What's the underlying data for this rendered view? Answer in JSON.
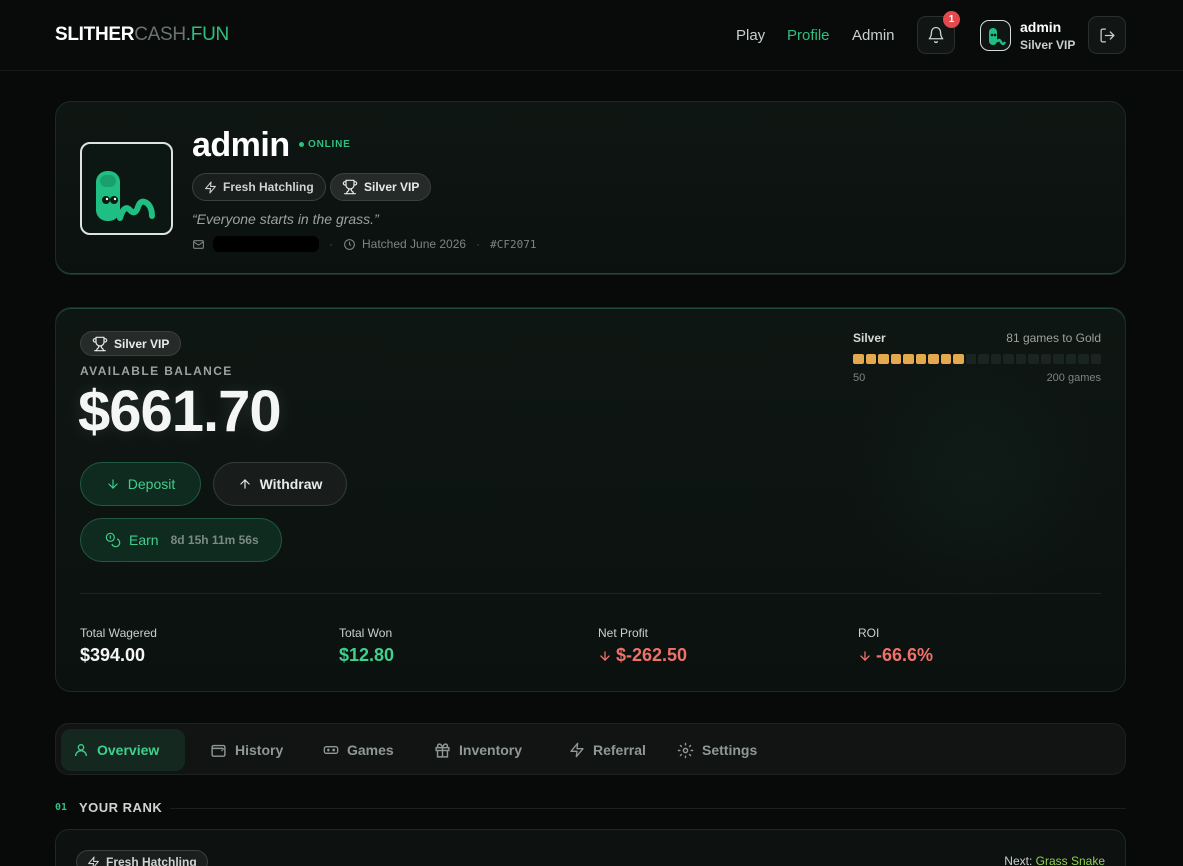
{
  "header": {
    "brand_part1": "SLITHER",
    "brand_part2": "CASH",
    "brand_part3": ".FUN",
    "nav": {
      "play": "Play",
      "profile": "Profile",
      "admin": "Admin"
    },
    "notification_count": "1",
    "user": {
      "name": "admin",
      "tier": "Silver VIP"
    }
  },
  "profile": {
    "name": "admin",
    "status": "ONLINE",
    "badges": {
      "rank": "Fresh Hatchling",
      "vip": "Silver VIP"
    },
    "quote": "“Everyone starts in the grass.”",
    "hatched": "Hatched June 2026",
    "id": "#CF2071"
  },
  "balance": {
    "vip_badge": "Silver VIP",
    "label": "AVAILABLE BALANCE",
    "amount": "$661.70",
    "deposit_label": "Deposit",
    "withdraw_label": "Withdraw",
    "earn_label": "Earn",
    "earn_timer": "8d 15h 11m 56s",
    "tier": {
      "current": "Silver",
      "next_text": "81 games to Gold",
      "min_label": "50",
      "max_label": "200 games",
      "segments_total": 20,
      "segments_filled": 9
    },
    "stats": {
      "wagered_label": "Total Wagered",
      "wagered": "$394.00",
      "won_label": "Total Won",
      "won": "$12.80",
      "profit_label": "Net Profit",
      "profit": "$-262.50",
      "roi_label": "ROI",
      "roi": "-66.6%"
    }
  },
  "tabs": [
    "Overview",
    "History",
    "Games",
    "Inventory",
    "Referral",
    "Settings"
  ],
  "rank_section": {
    "number": "01",
    "title": "YOUR RANK",
    "current_badge": "Fresh Hatchling",
    "next_prefix": "Next: ",
    "next_rank": "Grass Snake"
  },
  "colors": {
    "accent": "#2fbf7f",
    "vip_progress": "#e4a84e",
    "negative": "#f0716a",
    "badge_red": "#e5484d"
  }
}
